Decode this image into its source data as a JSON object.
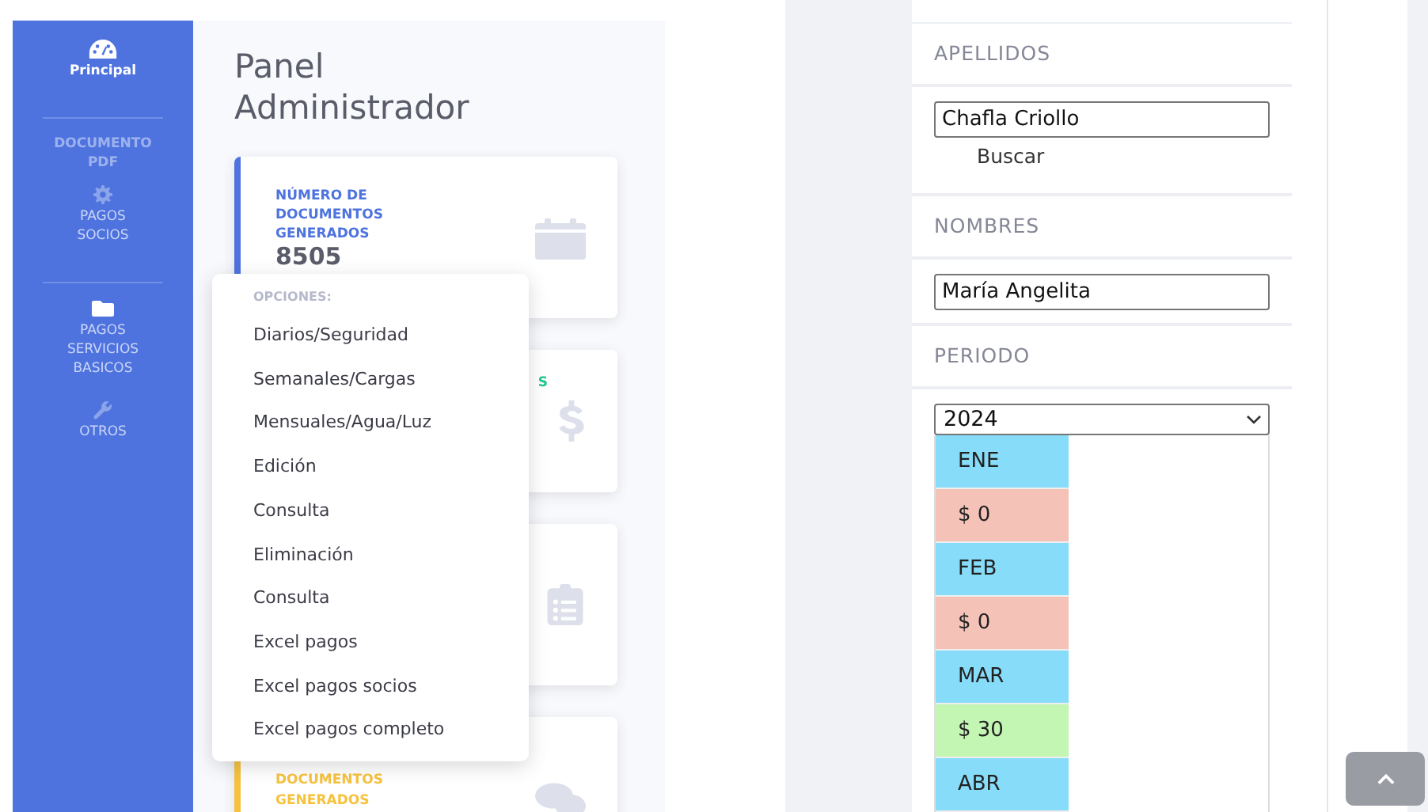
{
  "sidebar": {
    "items": [
      {
        "kind": "link",
        "label": "Principal",
        "active": true
      },
      {
        "kind": "divider"
      },
      {
        "kind": "heading",
        "label": "DOCUMENTO PDF"
      },
      {
        "kind": "link",
        "label": "PAGOS SOCIOS",
        "active": false
      },
      {
        "kind": "divider"
      },
      {
        "kind": "link",
        "label": "PAGOS SERVICIOS BASICOS",
        "active": false
      },
      {
        "kind": "link",
        "label": "OTROS",
        "active": false
      }
    ]
  },
  "page_title": "Panel Administrador",
  "cards": [
    {
      "kind": "calendar",
      "label": "NÚMERO DE DOCUMENTOS GENERADOS",
      "value": "8505",
      "color": "#4e73df"
    },
    {
      "kind": "dollar",
      "label": "S",
      "color": "#1cc88a"
    },
    {
      "kind": "clipboard"
    },
    {
      "kind": "comments",
      "label": "DOCUMENTOS GENERADOS",
      "color": "#f6c23e"
    }
  ],
  "dropdown_menu": {
    "header": "OPCIONES:",
    "items": [
      "Diarios/Seguridad",
      "Semanales/Cargas",
      "Mensuales/Agua/Luz",
      "Edición",
      "Consulta",
      "Eliminación",
      "Consulta",
      "Excel pagos",
      "Excel pagos socios",
      "Excel pagos completo"
    ]
  },
  "form": {
    "sections": [
      {
        "kind": "heading",
        "text": "APELLIDOS"
      },
      {
        "kind": "input",
        "value": "Chafla Criollo",
        "link": "Buscar"
      },
      {
        "kind": "heading",
        "text": "NOMBRES"
      },
      {
        "kind": "input",
        "value": "María Angelita"
      },
      {
        "kind": "heading",
        "text": "PERIODO"
      },
      {
        "kind": "select",
        "value": "2024"
      }
    ]
  },
  "months": [
    {
      "text": "ENE",
      "color": "#87dcf9"
    },
    {
      "text": "$ 0",
      "color": "#f5c2b8"
    },
    {
      "text": "FEB",
      "color": "#87dcf9"
    },
    {
      "text": "$ 0",
      "color": "#f5c2b8"
    },
    {
      "text": "MAR",
      "color": "#87dcf9"
    },
    {
      "text": "$ 30",
      "color": "#c3f5b3"
    },
    {
      "text": "ABR",
      "color": "#87dcf9"
    }
  ]
}
